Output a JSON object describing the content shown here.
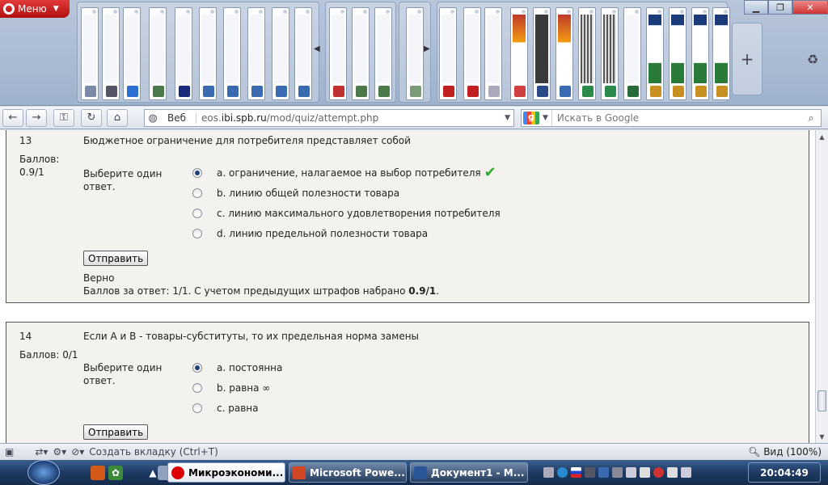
{
  "browser": {
    "menu_label": "Меню",
    "address": {
      "mode": "Веб",
      "url_prefix": "eos.",
      "url_host": "ibi.spb.ru",
      "url_path": "/mod/quiz/attempt.php"
    },
    "search": {
      "placeholder": "Искать в Google"
    },
    "status": {
      "new_tab": "Создать вкладку (Ctrl+T)",
      "zoom": "Вид (100%)"
    }
  },
  "quiz": {
    "q13": {
      "number": "13",
      "text": "Бюджетное ограничение для потребителя представляет собой",
      "grade_label": "Баллов:",
      "grade_value": "0.9/1",
      "prompt": "Выберите один ответ.",
      "options": [
        "a. ограничение, налагаемое на выбор потребителя",
        "b. линию общей полезности товара",
        "c. линию максимального удовлетворения потребителя",
        "d. линию предельной полезности товара"
      ],
      "selected": 0,
      "submit_label": "Отправить",
      "feedback_title": "Верно",
      "feedback_text": "Баллов за ответ: 1/1. С учетом предыдущих штрафов набрано ",
      "feedback_total": "0.9/1",
      "feedback_end": "."
    },
    "q14": {
      "number": "14",
      "text": "Если А и В - товары-субституты, то их предельная норма замены",
      "grade": "Баллов: 0/1",
      "prompt": "Выберите один ответ.",
      "options": [
        "a. постоянна",
        "b. равна ∞",
        "c. равна"
      ],
      "selected": 0,
      "submit_label": "Отправить"
    }
  },
  "taskbar": {
    "tasks": [
      "Микроэкономи...",
      "Microsoft Powe...",
      "Документ1 - M..."
    ],
    "clock": "20:04:49"
  }
}
